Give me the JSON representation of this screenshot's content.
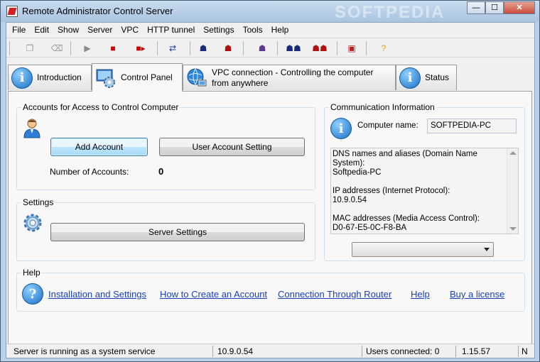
{
  "window": {
    "title": "Remote Administrator Control Server",
    "watermark": "SOFTPEDIA",
    "minimize_glyph": "—",
    "maximize_glyph": "☐",
    "close_glyph": "✕"
  },
  "menu": [
    "File",
    "Edit",
    "Show",
    "Server",
    "VPC",
    "HTTP tunnel",
    "Settings",
    "Tools",
    "Help"
  ],
  "toolbar": {
    "buttons": [
      {
        "name": "copy-icon",
        "glyph": "❐",
        "color": "#9a9a9a"
      },
      {
        "name": "eraser-icon",
        "glyph": "⌫",
        "color": "#9a9a9a"
      },
      {
        "name": "play-icon",
        "glyph": "▶",
        "color": "#8a8a8a"
      },
      {
        "name": "stop-icon",
        "glyph": "■",
        "color": "#cc0000"
      },
      {
        "name": "stop-and-start-icon",
        "glyph": "■▸",
        "color": "#cc0000"
      },
      {
        "name": "connections-icon",
        "glyph": "⇄",
        "color": "#1a3a9a"
      },
      {
        "name": "user-connect-icon",
        "glyph": "☗",
        "color": "#1a2a7a"
      },
      {
        "name": "user-disconnect-icon",
        "glyph": "☗",
        "color": "#b01010"
      },
      {
        "name": "user-settings-icon",
        "glyph": "☗",
        "color": "#5a3a8a"
      },
      {
        "name": "users-connect-icon",
        "glyph": "☗☗",
        "color": "#1a2a7a"
      },
      {
        "name": "users-disconnect-icon",
        "glyph": "☗☗",
        "color": "#b01010"
      },
      {
        "name": "server-config-icon",
        "glyph": "▣",
        "color": "#c01a1a"
      },
      {
        "name": "help-icon",
        "glyph": "?",
        "color": "#d6a800"
      }
    ]
  },
  "tabs": [
    {
      "label": "Introduction",
      "icon": "info-icon"
    },
    {
      "label": "Control Panel",
      "icon": "gear-monitor-icon"
    },
    {
      "label_line1": "VPC connection - Controlling the computer",
      "label_line2": "from anywhere",
      "icon": "globe-computer-icon"
    },
    {
      "label": "Status",
      "icon": "info-icon"
    }
  ],
  "accounts": {
    "group_title": "Accounts for Access to Control Computer",
    "add_button": "Add Account",
    "user_setting_button": "User Account Setting",
    "count_label": "Number of Accounts:",
    "count_value": "0"
  },
  "settings": {
    "group_title": "Settings",
    "server_settings_button": "Server Settings"
  },
  "communication": {
    "group_title": "Communication Information",
    "computer_name_label": "Computer name:",
    "computer_name_value": "SOFTPEDIA-PC",
    "lines": [
      "DNS names and aliases (Domain Name System):",
      "Softpedia-PC",
      "",
      "IP addresses (Internet Protocol):",
      "10.9.0.54",
      "",
      "MAC addresses (Media Access Control):",
      "D0-67-E5-0C-F8-BA"
    ],
    "combo_value": ""
  },
  "help": {
    "group_title": "Help",
    "links": [
      "Installation and Settings",
      "How to Create an Account",
      "Connection Through Router",
      "Help",
      "Buy a license"
    ]
  },
  "status": {
    "service": "Server is running as a system service",
    "ip": "10.9.0.54",
    "users": "Users connected: 0",
    "version": "1.15.57",
    "extra": "N"
  },
  "colors": {
    "link": "#1a3fbf",
    "info_icon": "#1a6fc6"
  }
}
